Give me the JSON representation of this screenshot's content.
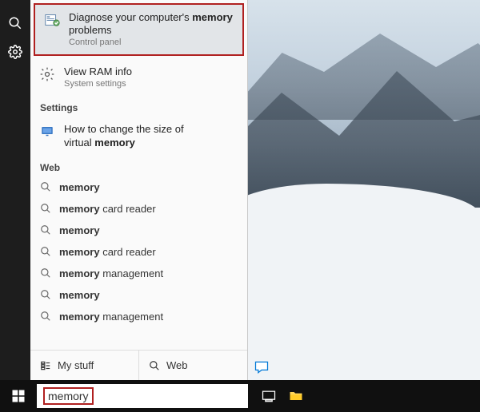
{
  "search": {
    "query": "memory",
    "best_match": {
      "title_pre": "Diagnose your computer's ",
      "title_bold": "memory",
      "title_post": " problems",
      "sub": "Control panel"
    },
    "second_result": {
      "title": "View RAM info",
      "sub": "System settings"
    },
    "sections": {
      "settings": "Settings",
      "web": "Web"
    },
    "settings_result": {
      "line1": "How to change the size of",
      "line2_pre": "virtual ",
      "line2_bold": "memory"
    },
    "web_results": [
      {
        "pre": "",
        "bold": "memory",
        "post": ""
      },
      {
        "pre": "",
        "bold": "memory",
        "post": " card reader"
      },
      {
        "pre": "",
        "bold": "memory",
        "post": ""
      },
      {
        "pre": "",
        "bold": "memory",
        "post": " card reader"
      },
      {
        "pre": "",
        "bold": "memory",
        "post": " management"
      },
      {
        "pre": "",
        "bold": "memory",
        "post": ""
      },
      {
        "pre": "",
        "bold": "memory",
        "post": " management"
      }
    ],
    "bottom": {
      "mystuff": "My stuff",
      "web": "Web"
    }
  }
}
